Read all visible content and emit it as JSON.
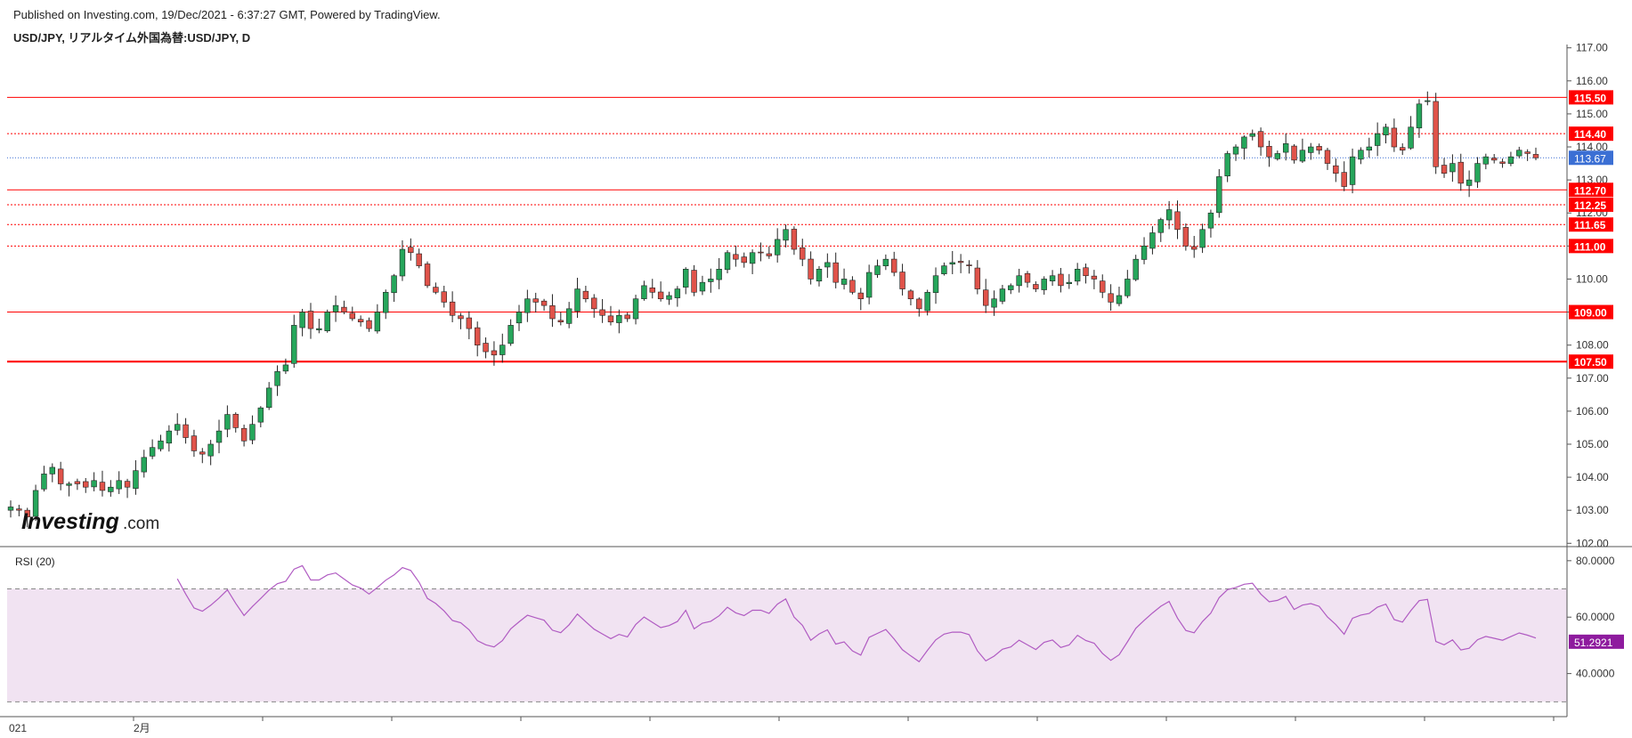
{
  "header": {
    "published": "Published on Investing.com, 19/Dec/2021 - 6:37:27 GMT, Powered by TradingView.",
    "symbol": "USD/JPY, リアルタイム外国為替:USD/JPY, D"
  },
  "watermark": {
    "brand": "Investing",
    "suffix": ".com"
  },
  "colors": {
    "up": "#26a65b",
    "down": "#e0534a",
    "level": "#ff0000",
    "current": "#3b6fd4",
    "rsi_line": "#b05bc2",
    "rsi_band": "#f1e3f2",
    "rsi_badge": "#8e1b9e"
  },
  "chart_data": [
    {
      "type": "candlestick",
      "title": "USD/JPY",
      "y_axis": {
        "ticks": [
          "102.00",
          "103.00",
          "104.00",
          "105.00",
          "106.00",
          "107.00",
          "108.00",
          "109.00",
          "110.00",
          "111.00",
          "112.00",
          "113.00",
          "114.00",
          "115.00",
          "116.00",
          "117.00"
        ],
        "range": [
          101.9,
          117.1
        ]
      },
      "x_axis": {
        "labels": [
          "021",
          "2月"
        ]
      },
      "levels": [
        {
          "value": 115.5,
          "label": "115.50",
          "style": "solid"
        },
        {
          "value": 114.4,
          "label": "114.40",
          "style": "dotted"
        },
        {
          "value": 112.7,
          "label": "112.70",
          "style": "solid"
        },
        {
          "value": 112.25,
          "label": "112.25",
          "style": "dotted"
        },
        {
          "value": 111.65,
          "label": "111.65",
          "style": "dotted"
        },
        {
          "value": 111.0,
          "label": "111.00",
          "style": "dotted"
        },
        {
          "value": 109.0,
          "label": "109.00",
          "style": "solid"
        },
        {
          "value": 107.5,
          "label": "107.50",
          "style": "thick"
        }
      ],
      "current_price": {
        "value": 113.67,
        "label": "113.67"
      },
      "closes": [
        103.1,
        103.0,
        102.8,
        103.6,
        104.1,
        104.3,
        103.8,
        103.8,
        103.8,
        103.7,
        103.9,
        103.6,
        103.7,
        103.9,
        103.7,
        104.2,
        104.6,
        104.9,
        105.1,
        105.4,
        105.6,
        105.2,
        104.8,
        104.7,
        105.0,
        105.4,
        105.9,
        105.5,
        105.1,
        105.6,
        106.1,
        106.7,
        107.2,
        107.4,
        108.6,
        109.0,
        108.5,
        108.5,
        109.0,
        109.2,
        109.0,
        108.8,
        108.7,
        108.5,
        109.0,
        109.6,
        110.1,
        110.9,
        110.8,
        110.4,
        109.8,
        109.6,
        109.3,
        108.9,
        108.8,
        108.5,
        108.0,
        107.8,
        107.7,
        108.0,
        108.6,
        109.0,
        109.4,
        109.3,
        109.2,
        108.8,
        108.7,
        109.1,
        109.7,
        109.4,
        109.1,
        108.9,
        108.7,
        108.9,
        108.8,
        109.4,
        109.8,
        109.6,
        109.4,
        109.5,
        109.7,
        110.3,
        109.6,
        109.9,
        110.0,
        110.3,
        110.8,
        110.6,
        110.5,
        110.8,
        110.8,
        110.7,
        111.2,
        111.5,
        110.9,
        110.6,
        110.0,
        110.3,
        110.5,
        109.9,
        110.0,
        109.6,
        109.4,
        110.2,
        110.4,
        110.6,
        110.2,
        109.7,
        109.4,
        109.1,
        109.6,
        110.1,
        110.4,
        110.5,
        110.5,
        110.4,
        109.7,
        109.2,
        109.4,
        109.7,
        109.8,
        110.1,
        109.9,
        109.7,
        110.0,
        110.1,
        109.8,
        109.9,
        110.3,
        110.1,
        110.0,
        109.6,
        109.3,
        109.5,
        110.0,
        110.6,
        111.0,
        111.4,
        111.8,
        112.1,
        111.5,
        111.0,
        110.9,
        111.5,
        112.0,
        113.1,
        113.8,
        114.0,
        114.3,
        114.4,
        114.0,
        113.7,
        113.8,
        114.1,
        113.6,
        113.9,
        114.0,
        113.9,
        113.5,
        113.2,
        112.8,
        113.7,
        113.9,
        114.0,
        114.4,
        114.6,
        114.0,
        113.9,
        114.6,
        115.3,
        115.4,
        113.4,
        113.2,
        113.5,
        112.9,
        113.0,
        113.5,
        113.7,
        113.6,
        113.5,
        113.7,
        113.9,
        113.8,
        113.67
      ],
      "rsi": {
        "name": "RSI (20)",
        "period": 20,
        "y_axis": {
          "ticks": [
            "40.0000",
            "60.0000",
            "80.0000"
          ],
          "range": [
            26,
            85
          ]
        },
        "bands": [
          30,
          70
        ],
        "current": {
          "value": 51.2921,
          "label": "51.2921"
        }
      }
    }
  ]
}
